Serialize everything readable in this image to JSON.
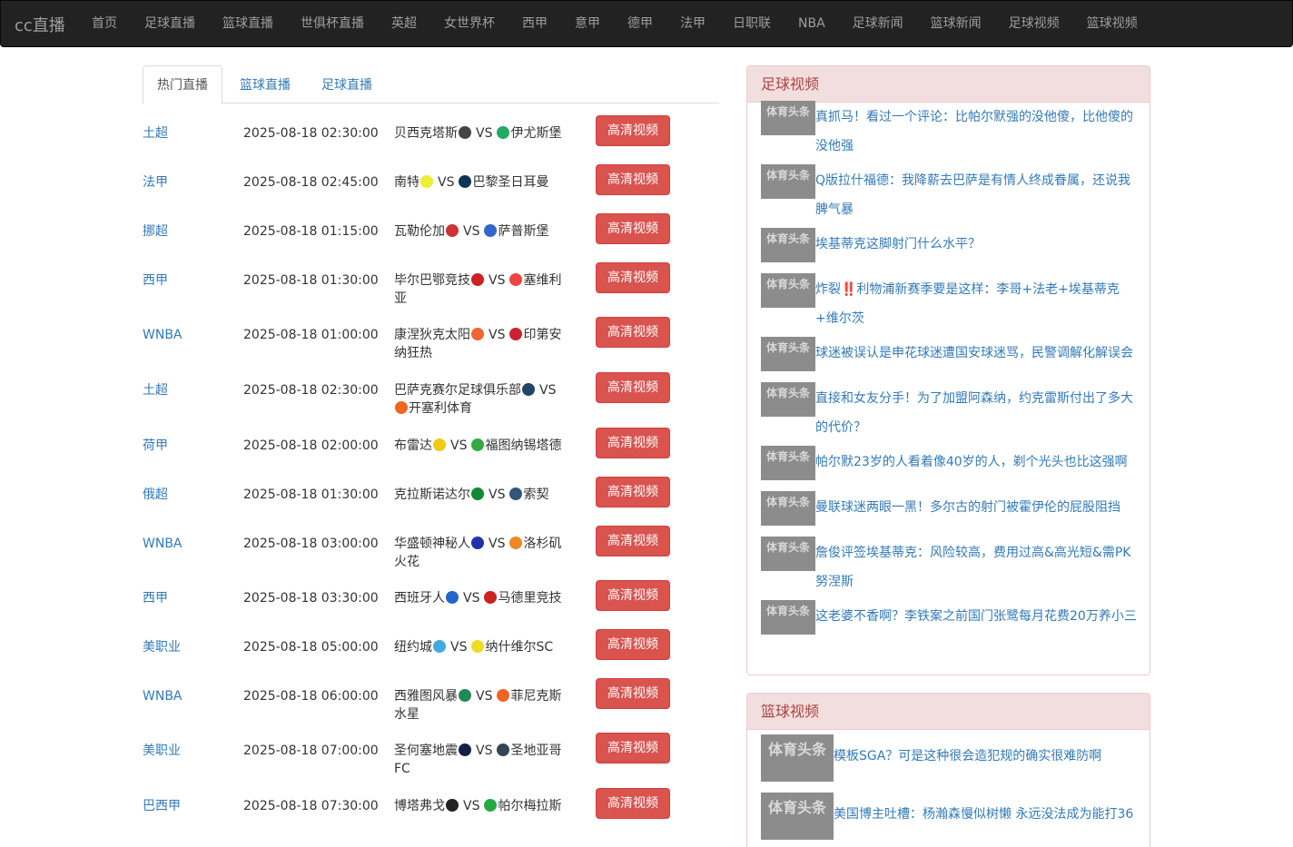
{
  "brand": "cc直播",
  "nav": [
    "首页",
    "足球直播",
    "篮球直播",
    "世俱杯直播",
    "英超",
    "女世界杯",
    "西甲",
    "意甲",
    "德甲",
    "法甲",
    "日职联",
    "NBA",
    "足球新闻",
    "篮球新闻",
    "足球视频",
    "篮球视频"
  ],
  "tabs": [
    "热门直播",
    "篮球直播",
    "足球直播"
  ],
  "watch_label": "高清视频",
  "vs_label": "VS",
  "matches": [
    {
      "league": "土超",
      "time": "2025-08-18 02:30:00",
      "home": "贝西克塔斯",
      "away": "伊尤斯堡",
      "home_color": "#444",
      "away_color": "#2a6"
    },
    {
      "league": "法甲",
      "time": "2025-08-18 02:45:00",
      "home": "南特",
      "away": "巴黎圣日耳曼",
      "home_color": "#ee3",
      "away_color": "#135"
    },
    {
      "league": "挪超",
      "time": "2025-08-18 01:15:00",
      "home": "瓦勒伦加",
      "away": "萨普斯堡",
      "home_color": "#c33",
      "away_color": "#36c"
    },
    {
      "league": "西甲",
      "time": "2025-08-18 01:30:00",
      "home": "毕尔巴鄂竞技",
      "away": "塞维利亚",
      "home_color": "#c22",
      "away_color": "#e44"
    },
    {
      "league": "WNBA",
      "time": "2025-08-18 01:00:00",
      "home": "康涅狄克太阳",
      "away": "印第安纳狂热",
      "home_color": "#e63",
      "away_color": "#c23"
    },
    {
      "league": "土超",
      "time": "2025-08-18 02:30:00",
      "home": "巴萨克赛尔足球俱乐部",
      "away": "开塞利体育",
      "home_color": "#246",
      "away_color": "#e62"
    },
    {
      "league": "荷甲",
      "time": "2025-08-18 02:00:00",
      "home": "布雷达",
      "away": "福图纳锡塔德",
      "home_color": "#ec1",
      "away_color": "#3a4"
    },
    {
      "league": "俄超",
      "time": "2025-08-18 01:30:00",
      "home": "克拉斯诺达尔",
      "away": "索契",
      "home_color": "#183",
      "away_color": "#357"
    },
    {
      "league": "WNBA",
      "time": "2025-08-18 03:00:00",
      "home": "华盛顿神秘人",
      "away": "洛杉矶火花",
      "home_color": "#23a",
      "away_color": "#e82"
    },
    {
      "league": "西甲",
      "time": "2025-08-18 03:30:00",
      "home": "西班牙人",
      "away": "马德里竞技",
      "home_color": "#26c",
      "away_color": "#c22"
    },
    {
      "league": "美职业",
      "time": "2025-08-18 05:00:00",
      "home": "纽约城",
      "away": "纳什维尔SC",
      "home_color": "#4ad",
      "away_color": "#ed2"
    },
    {
      "league": "WNBA",
      "time": "2025-08-18 06:00:00",
      "home": "西雅图风暴",
      "away": "菲尼克斯水星",
      "home_color": "#285",
      "away_color": "#e62"
    },
    {
      "league": "美职业",
      "time": "2025-08-18 07:00:00",
      "home": "圣何塞地震",
      "away": "圣地亚哥FC",
      "home_color": "#124",
      "away_color": "#345"
    },
    {
      "league": "巴西甲",
      "time": "2025-08-18 07:30:00",
      "home": "博塔弗戈",
      "away": "帕尔梅拉斯",
      "home_color": "#222",
      "away_color": "#2a4"
    }
  ],
  "football_panel": {
    "title": "足球视频",
    "thumb_text": "体育头条",
    "items": [
      "真抓马！看过一个评论：比帕尔默强的没他傻，比他傻的没他强",
      "Q版拉什福德：我降薪去巴萨是有情人终成眷属，还说我脾气暴",
      "埃基蒂克这脚射门什么水平？",
      "炸裂‼️利物浦新赛季要是这样：李哥+法老+埃基蒂克+维尔茨",
      "球迷被误认是申花球迷遭国安球迷骂，民警调解化解误会",
      "直接和女友分手！为了加盟阿森纳，约克雷斯付出了多大的代价？",
      "帕尔默23岁的人看着像40岁的人，剃个光头也比这强啊",
      "曼联球迷两眼一黑！多尔古的射门被霍伊伦的屁股阻挡",
      "詹俊评签埃基蒂克：风险较高，费用过高&高光短&需PK努涅斯",
      "这老婆不香啊？李铁案之前国门张鹭每月花费20万养小三"
    ]
  },
  "basketball_panel": {
    "title": "篮球视频",
    "thumb_text": "体育头条",
    "items": [
      "模板SGA？可是这种很会造犯规的确实很难防啊",
      "美国博主吐槽：杨瀚森慢似树懒 永远没法成为能打36"
    ]
  }
}
